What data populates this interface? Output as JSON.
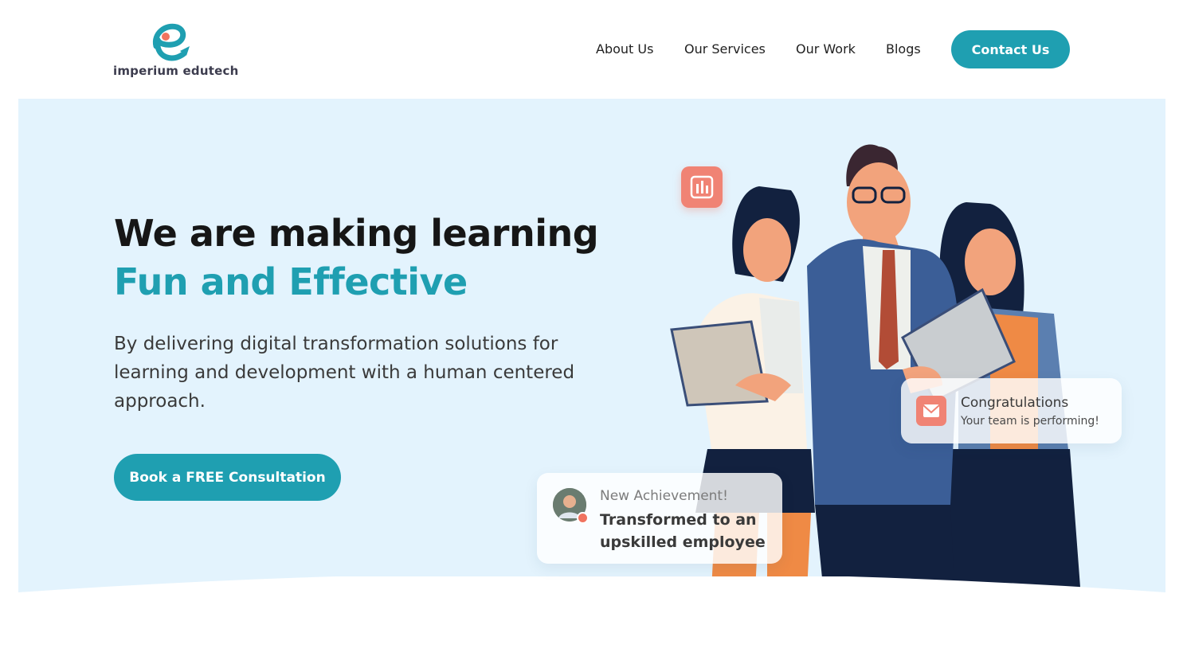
{
  "brand": {
    "name": "imperium edutech",
    "accent_color": "#1f9fb1",
    "secondary_color": "#f08374"
  },
  "nav": {
    "items": [
      {
        "label": "About Us"
      },
      {
        "label": "Our Services"
      },
      {
        "label": "Our Work"
      },
      {
        "label": "Blogs"
      }
    ],
    "contact_label": "Contact Us"
  },
  "hero": {
    "headline_line1": "We are making learning",
    "headline_line2": "Fun and Effective",
    "subtext": "By delivering digital transformation solutions for learning and development with a human centered approach.",
    "cta_label": "Book a FREE Consultation",
    "background_color": "#e3f3fd"
  },
  "cards": {
    "congrats": {
      "icon": "mail-icon",
      "title": "Congratulations",
      "subtitle": "Your team is performing!"
    },
    "achievement": {
      "icon": "avatar",
      "title": "New Achievement!",
      "text": "Transformed to an upskilled employee"
    }
  },
  "illustration": {
    "icon": "bar-chart-icon",
    "description_icon": "business-people-illustration"
  }
}
